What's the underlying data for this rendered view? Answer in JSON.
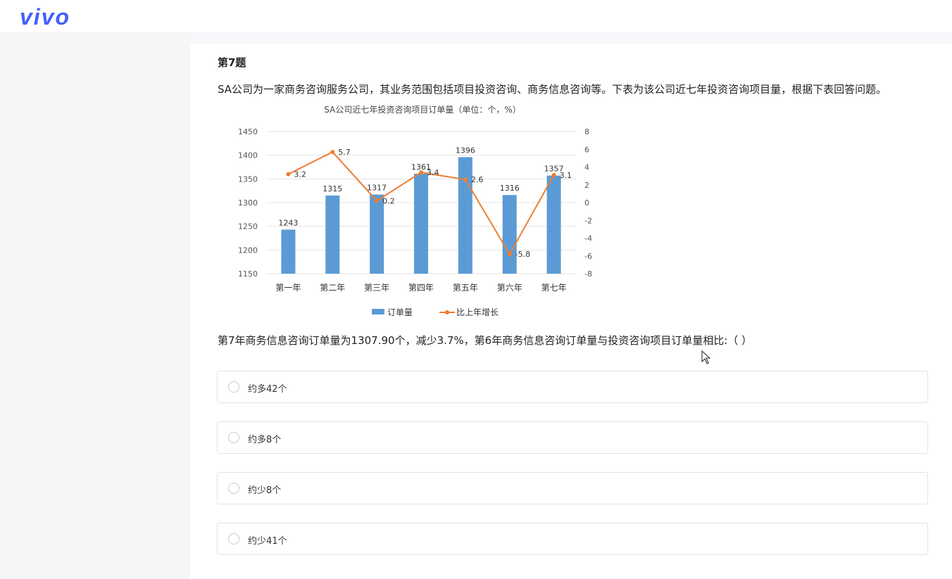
{
  "brand": {
    "logo_text": "vivo",
    "color": "#415fff"
  },
  "question": {
    "number": "第7题",
    "stem": "SA公司为一家商务咨询服务公司，其业务范围包括项目投资咨询、商务信息咨询等。下表为该公司近七年投资咨询项目量，根据下表回答问题。",
    "sub_question": "第7年商务信息咨询订单量为1307.90个，减少3.7%，第6年商务信息咨询订单量与投资咨询项目订单量相比:（ ）",
    "options": [
      {
        "label": "约多42个"
      },
      {
        "label": "约多8个"
      },
      {
        "label": "约少8个"
      },
      {
        "label": "约少41个"
      }
    ]
  },
  "chart_data": {
    "type": "bar",
    "title": "SA公司近七年投资咨询项目订单量（单位：个，%）",
    "categories": [
      "第一年",
      "第二年",
      "第三年",
      "第四年",
      "第五年",
      "第六年",
      "第七年"
    ],
    "series": [
      {
        "name": "订单量",
        "type": "bar",
        "axis": "left",
        "values": [
          1243,
          1315,
          1317,
          1361,
          1396,
          1316,
          1357
        ],
        "color": "#5b9bd5"
      },
      {
        "name": "比上年增长",
        "type": "line",
        "axis": "right",
        "values": [
          3.2,
          5.7,
          0.2,
          3.4,
          2.6,
          -5.8,
          3.1
        ],
        "color": "#ed7d31"
      }
    ],
    "ylim_left": [
      1150,
      1450
    ],
    "yticks_left": [
      1150,
      1200,
      1250,
      1300,
      1350,
      1400,
      1450
    ],
    "ylim_right": [
      -8,
      8
    ],
    "yticks_right": [
      -8,
      -6,
      -4,
      -2,
      0,
      2,
      4,
      6,
      8
    ],
    "grid": true,
    "legend_position": "bottom"
  }
}
